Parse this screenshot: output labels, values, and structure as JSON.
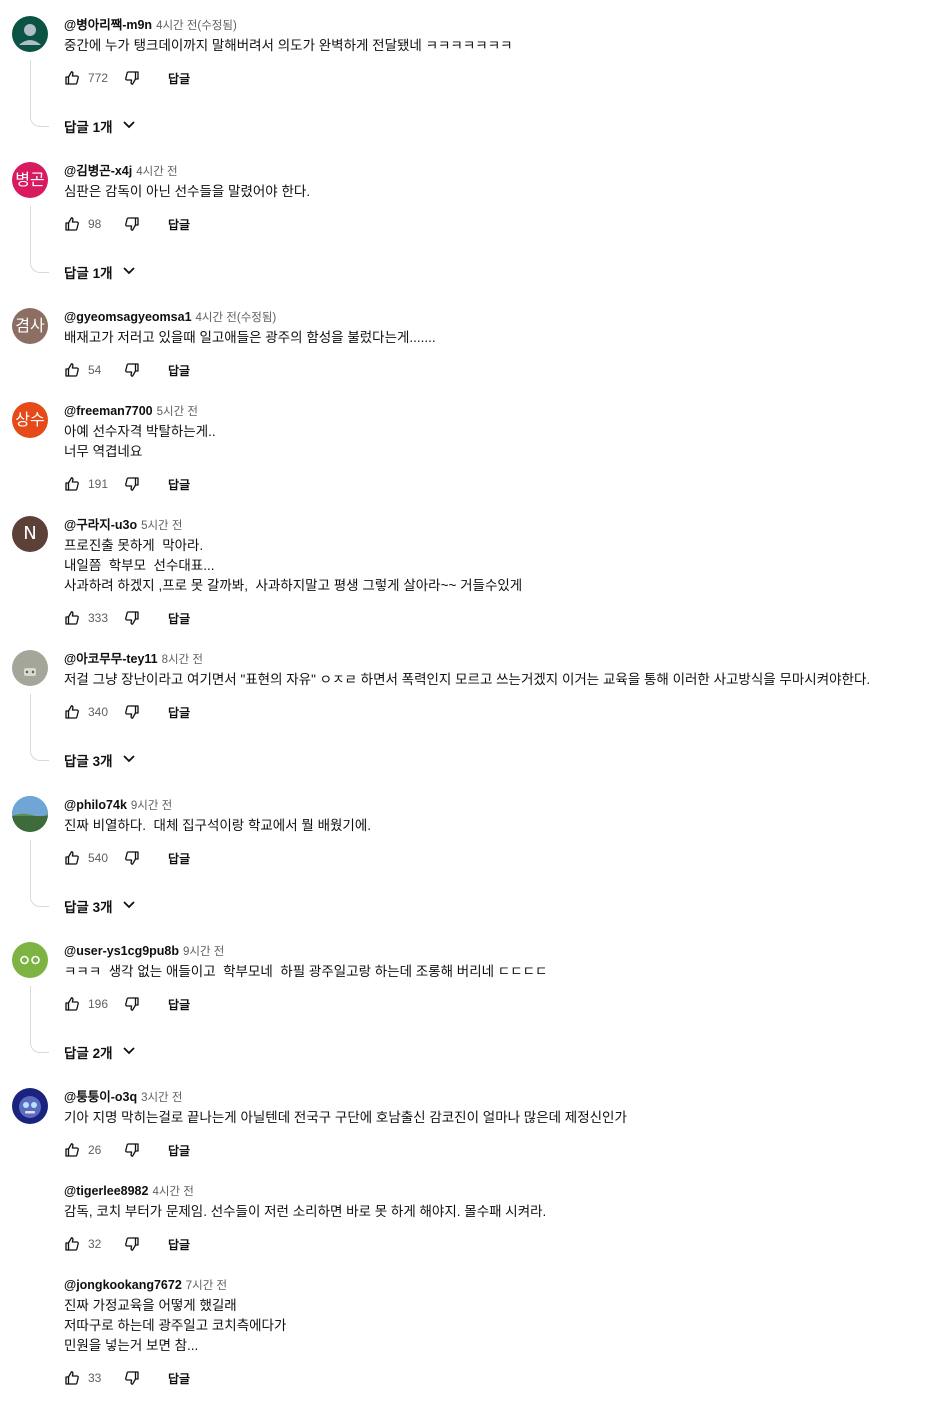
{
  "comments": [
    {
      "author": "@병아리짹-m9n",
      "time": "4시간 전(수정됨)",
      "text": "중간에 누가 탱크데이까지 말해버려서 의도가 완벽하게 전달됐네 ㅋㅋㅋㅋㅋㅋㅋ",
      "likes": "772",
      "reply": "답글",
      "replies": "답글 1개",
      "avatar_text": "",
      "avatar_color": "#0b5345"
    },
    {
      "author": "@김병곤-x4j",
      "time": "4시간 전",
      "text": "심판은 감독이 아닌 선수들을 말렸어야 한다.",
      "likes": "98",
      "reply": "답글",
      "replies": "답글 1개",
      "avatar_text": "병곤",
      "avatar_color": "#d81b60"
    },
    {
      "author": "@gyeomsagyeomsa1",
      "time": "4시간 전(수정됨)",
      "text": "배재고가 저러고 있을때 일고애들은 광주의 함성을 불렀다는게.......",
      "likes": "54",
      "reply": "답글",
      "avatar_text": "겸사",
      "avatar_color": "#8d6e63"
    },
    {
      "author": "@freeman7700",
      "time": "5시간 전",
      "text": "아예 선수자격 박탈하는게..\n너무 역겹네요",
      "likes": "191",
      "reply": "답글",
      "avatar_text": "상수",
      "avatar_color": "#e64a19"
    },
    {
      "author": "@구라지-u3o",
      "time": "5시간 전",
      "text": "프로진출 못하게  막아라.\n내일쯤  학부모  선수대표...\n사과하려 하겠지 ,프로 못 갈까봐,  사과하지말고 평생 그렇게 살아라~~ 거들수있게",
      "likes": "333",
      "reply": "답글",
      "avatar_text": "N",
      "avatar_color": "#5d4037"
    },
    {
      "author": "@아코무무-tey11",
      "time": "8시간 전",
      "text": "저걸 그냥 장난이라고 여기면서 \"표현의 자유\" ㅇㅈㄹ 하면서 폭력인지 모르고 쓰는거겠지 이거는 교육을 통해 이러한 사고방식을 무마시켜야한다.",
      "likes": "340",
      "reply": "답글",
      "replies": "답글 3개",
      "avatar_text": "",
      "avatar_color": "#a5a69a"
    },
    {
      "author": "@philo74k",
      "time": "9시간 전",
      "text": "진짜 비열하다.  대체 집구석이랑 학교에서 뭘 배웠기에.",
      "likes": "540",
      "reply": "답글",
      "replies": "답글 3개",
      "avatar_text": "",
      "avatar_color": "#4a7fb5"
    },
    {
      "author": "@user-ys1cg9pu8b",
      "time": "9시간 전",
      "text": "ㅋㅋㅋ  생각 없는 애들이고  학부모네  하필 광주일고랑 하는데 조롱해 버리네 ㄷㄷㄷㄷ",
      "likes": "196",
      "reply": "답글",
      "replies": "답글 2개",
      "avatar_text": "",
      "avatar_color": "#7cb342"
    },
    {
      "author": "@퉁퉁이-o3q",
      "time": "3시간 전",
      "text": "기아 지명 막히는걸로 끝나는게 아닐텐데 전국구 구단에 호남출신 감코진이 얼마나 많은데 제정신인가",
      "likes": "26",
      "reply": "답글",
      "avatar_text": "",
      "avatar_color": "#1a237e"
    },
    {
      "author": "@tigerlee8982",
      "time": "4시간 전",
      "text": "감독, 코치 부터가 문제임. 선수들이 저런 소리하면 바로 못 하게 해야지. 몰수패 시켜라.",
      "likes": "32",
      "reply": "답글"
    },
    {
      "author": "@jongkookang7672",
      "time": "7시간 전",
      "text": "진짜 가정교육을 어떻게 했길래\n저따구로 하는데 광주일고 코치측에다가\n민원을 넣는거 보면 참...",
      "likes": "33",
      "reply": "답글"
    }
  ]
}
